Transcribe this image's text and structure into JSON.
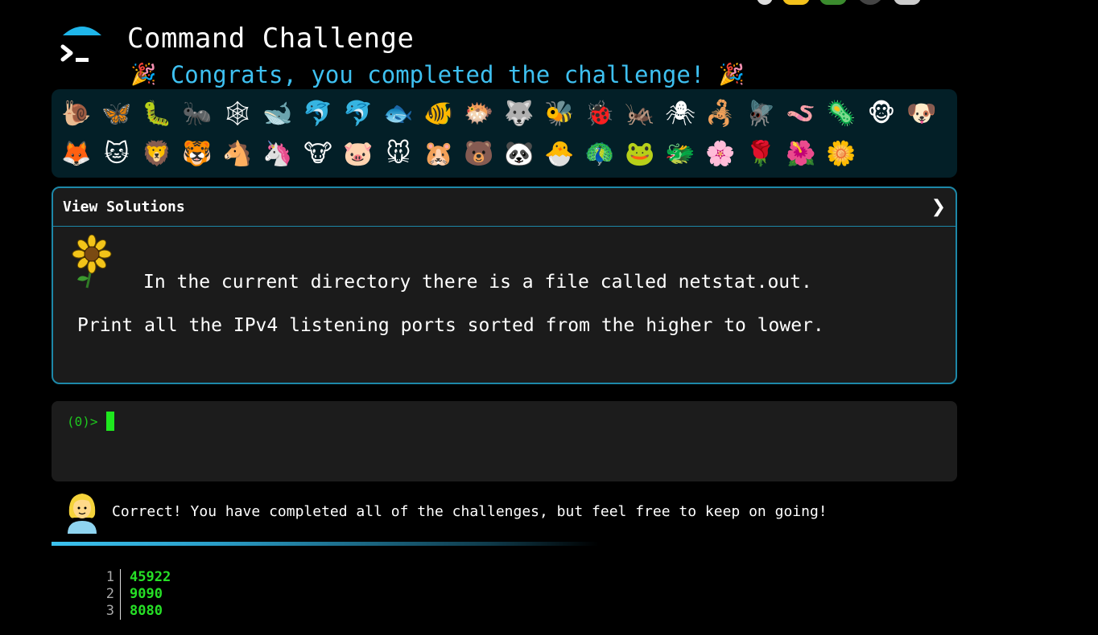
{
  "header": {
    "title": "Command Challenge",
    "congrats": "Congrats, you completed the challenge!",
    "party_emoji": "🎉"
  },
  "emoji_rows": [
    [
      "🐌",
      "🦋",
      "🐛",
      "🐜",
      "🕸",
      "🐋",
      "🐬",
      "🐬",
      "🐟",
      "🐠",
      "🐡",
      "🐺",
      "🐝",
      "🐞",
      "🦗",
      "🕷",
      "🦂",
      "🪰",
      "🪱",
      "🦠",
      "🐵",
      "🐶"
    ],
    [
      "🦊",
      "🐱",
      "🦁",
      "🐯",
      "🐴",
      "🦄",
      "🐮",
      "🐷",
      "🐭",
      "🐹",
      "🐻",
      "🐼",
      "🐣",
      "🦚",
      "🐸",
      "🐲",
      "🌸",
      "🌹",
      "🌺",
      "🌼"
    ]
  ],
  "solutions": {
    "title": "View Solutions",
    "chevron": "❯",
    "line1": "In the current directory there is a file called netstat.out.",
    "line2": "Print all the IPv4 listening ports sorted from the higher to lower."
  },
  "terminal": {
    "prompt": "(0)>"
  },
  "feedback": {
    "message": "Correct! You have completed all of the challenges, but feel free to keep on going!"
  },
  "output": {
    "lines": [
      {
        "num": "1",
        "value": "45922"
      },
      {
        "num": "2",
        "value": "9090"
      },
      {
        "num": "3",
        "value": "8080"
      }
    ]
  },
  "colors": {
    "accent": "#3ec0f0",
    "panel_bg": "#031f27",
    "border": "#1d88a8",
    "terminal_green": "#1ec81e"
  },
  "icons": [
    "terminal-logo-icon",
    "sunflower-icon",
    "assistant-woman-icon",
    "chevron-right-icon",
    "party-popper-icon"
  ]
}
